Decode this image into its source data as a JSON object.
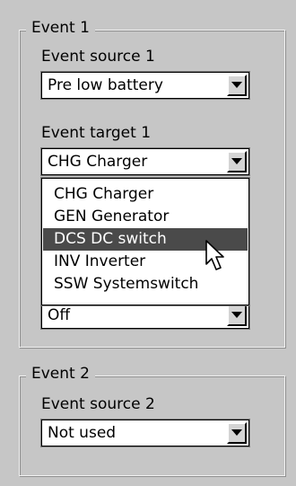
{
  "event1": {
    "legend": "Event 1",
    "source_label": "Event source 1",
    "source_value": "Pre low battery",
    "target_label": "Event target 1",
    "target_value": "CHG Charger",
    "hidden_value": "Off",
    "dropdown": {
      "items": [
        "CHG Charger",
        "GEN Generator",
        "DCS DC switch",
        "INV Inverter",
        "SSW Systemswitch"
      ],
      "highlighted": "DCS DC switch"
    }
  },
  "event2": {
    "legend": "Event 2",
    "source_label": "Event source 2",
    "source_value": "Not used"
  },
  "icons": {
    "dropdown_arrow": "triangle-down-icon",
    "cursor": "mouse-pointer-icon"
  }
}
